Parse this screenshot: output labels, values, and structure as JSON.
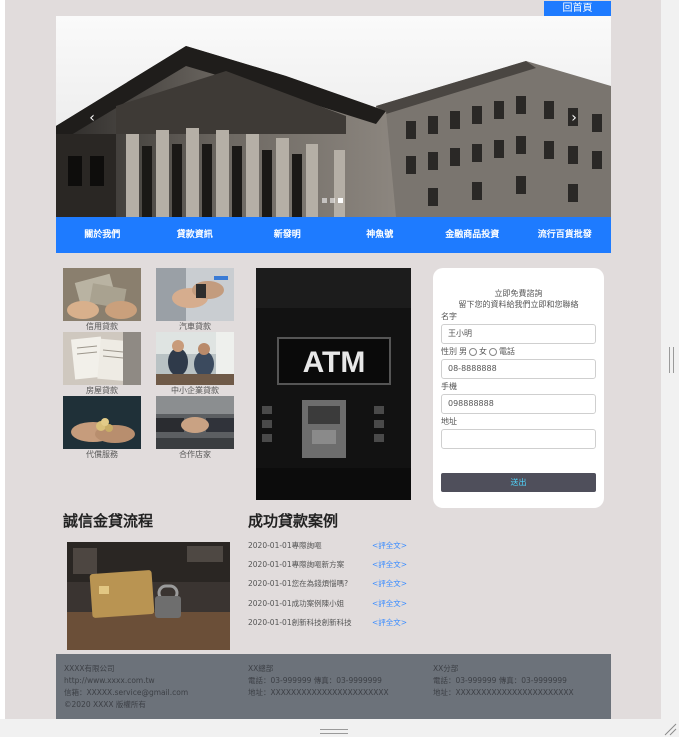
{
  "header": {
    "home_label": "回首頁"
  },
  "hero": {
    "prev": "‹",
    "next": "›",
    "slide_count": 3,
    "active_slide": 2
  },
  "nav": {
    "items": [
      "關於我們",
      "貸款資訊",
      "新發明",
      "神魚號",
      "金融商品投資",
      "流行百貨批發"
    ]
  },
  "services": [
    {
      "label": "信用貸款"
    },
    {
      "label": "汽車貸款"
    },
    {
      "label": "房屋貸款"
    },
    {
      "label": "中小企業貸款"
    },
    {
      "label": "代償服務"
    },
    {
      "label": "合作店家"
    }
  ],
  "atm_sign": "ATM",
  "form": {
    "title_line1": "立即免費諮詢",
    "title_line2": "留下您的資料給我們立即和您聯絡",
    "name_label": "名字",
    "name_value": "王小明",
    "gender_label": "性別",
    "gender_male": "男",
    "gender_female": "女",
    "phone_label": "電話",
    "phone_value": "08-8888888",
    "mobile_label": "手機",
    "mobile_value": "098888888",
    "address_label": "地址",
    "address_value": "",
    "submit_label": "送出"
  },
  "process": {
    "heading": "誠信金貸流程"
  },
  "cases": {
    "heading": "成功貸款案例",
    "items": [
      {
        "title": "2020-01-01專際詢嘔",
        "more": "<評全文>"
      },
      {
        "title": "2020-01-01專際詢嘔新方案",
        "more": "<評全文>"
      },
      {
        "title": "2020-01-01您在為錢煩惱嗎?",
        "more": "<評全文>"
      },
      {
        "title": "2020-01-01成功案例陳小姐",
        "more": "<評全文>"
      },
      {
        "title": "2020-01-01創新科技創新科技",
        "more": "<評全文>"
      }
    ]
  },
  "footer": {
    "company": "XXXX有限公司",
    "website": "http://www.xxxx.com.tw",
    "email": "信箱：XXXXX.service@gmail.com",
    "copyright": "©2020 XXXX 版權所有",
    "branch1_name": "XX總部",
    "branch1_phone": "電話：03-999999 傳真：03-9999999",
    "branch1_addr": "地址：XXXXXXXXXXXXXXXXXXXXXXX",
    "branch2_name": "XX分部",
    "branch2_phone": "電話：03-999999 傳真：03-9999999",
    "branch2_addr": "地址：XXXXXXXXXXXXXXXXXXXXXXX"
  },
  "colors": {
    "accent": "#1e7bff",
    "page_bg": "#e1dcdc",
    "footer_bg": "#6c727a",
    "submit_bg": "#4f4f5b",
    "link": "#3a8cff"
  }
}
